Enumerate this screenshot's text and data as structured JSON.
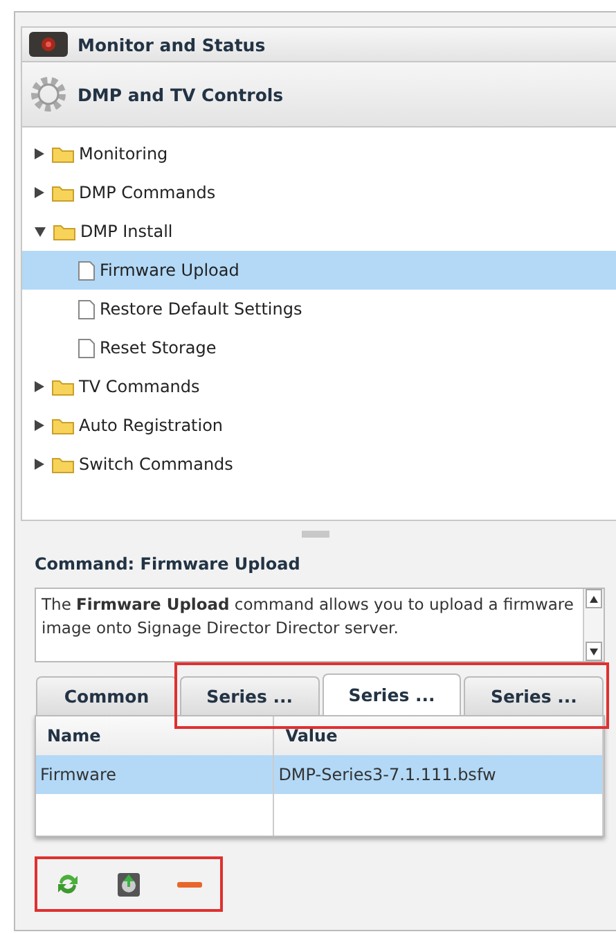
{
  "accordion": [
    {
      "title": "Monitor and Status",
      "kind": "monitor"
    },
    {
      "title": "DMP and TV Controls",
      "kind": "gear"
    }
  ],
  "tree": [
    {
      "label": "Monitoring",
      "kind": "folder",
      "expanded": false,
      "selected": false
    },
    {
      "label": "DMP Commands",
      "kind": "folder",
      "expanded": false,
      "selected": false
    },
    {
      "label": "DMP Install",
      "kind": "folder",
      "expanded": true,
      "selected": false,
      "children": [
        {
          "label": "Firmware Upload",
          "kind": "file",
          "selected": true
        },
        {
          "label": "Restore Default Settings",
          "kind": "file",
          "selected": false
        },
        {
          "label": "Reset Storage",
          "kind": "file",
          "selected": false
        }
      ]
    },
    {
      "label": "TV Commands",
      "kind": "folder",
      "expanded": false,
      "selected": false
    },
    {
      "label": "Auto Registration",
      "kind": "folder",
      "expanded": false,
      "selected": false
    },
    {
      "label": "Switch Commands",
      "kind": "folder",
      "expanded": false,
      "selected": false
    }
  ],
  "command": {
    "title": "Command: Firmware Upload",
    "description": "The **Firmware Upload** command allows you to upload a firmware image onto Signage Director Director server."
  },
  "tab_groups": [
    {
      "highlighted": false,
      "tabs": [
        {
          "label": "Common",
          "selected": false
        }
      ]
    },
    {
      "highlighted": true,
      "tabs": [
        {
          "label": "Series ...",
          "selected": false
        },
        {
          "label": "Series ...",
          "selected": true
        },
        {
          "label": "Series ...",
          "selected": false
        }
      ]
    }
  ],
  "table": {
    "columns": [
      "Name",
      "Value"
    ],
    "rows": [
      {
        "cells": [
          "Firmware",
          "DMP-Series3-7.1.111.bsfw"
        ],
        "selected": true
      }
    ]
  },
  "toolbar": {
    "highlighted": true,
    "buttons": [
      {
        "kind": "refresh"
      },
      {
        "kind": "upload"
      },
      {
        "kind": "remove"
      }
    ]
  }
}
